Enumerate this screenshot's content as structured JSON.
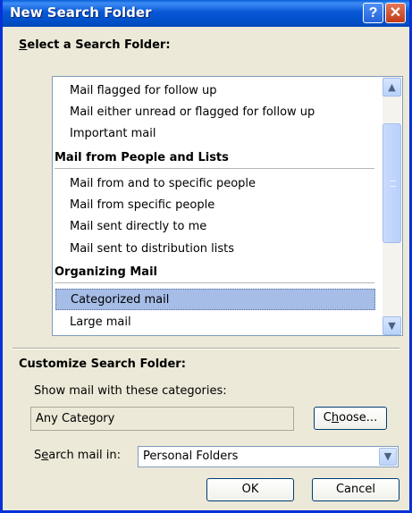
{
  "window": {
    "title": "New Search Folder",
    "help": "?",
    "close": "✕"
  },
  "select_section": {
    "title_accel": "S",
    "title_rest": "elect a Search Folder:"
  },
  "list": {
    "items": [
      "Mail flagged for follow up",
      "Mail either unread or flagged for follow up",
      "Important mail"
    ],
    "people_group": "Mail from People and Lists",
    "people_items": [
      "Mail from and to specific people",
      "Mail from specific people",
      "Mail sent directly to me",
      "Mail sent to distribution lists"
    ],
    "organizing_group": "Organizing Mail",
    "selected_item": "Categorized mail",
    "large_item": "Large mail"
  },
  "customize": {
    "title": "Customize Search Folder:",
    "categories_label": "Show mail with these categories:",
    "category_value": "Any Category",
    "choose_pre": "C",
    "choose_accel": "h",
    "choose_post": "oose...",
    "search_pre": "S",
    "search_accel": "e",
    "search_post": "arch mail in:",
    "search_value": "Personal Folders"
  },
  "buttons": {
    "ok": "OK",
    "cancel": "Cancel"
  },
  "icons": {
    "up": "▲",
    "down": "▼",
    "combo": "▼"
  }
}
